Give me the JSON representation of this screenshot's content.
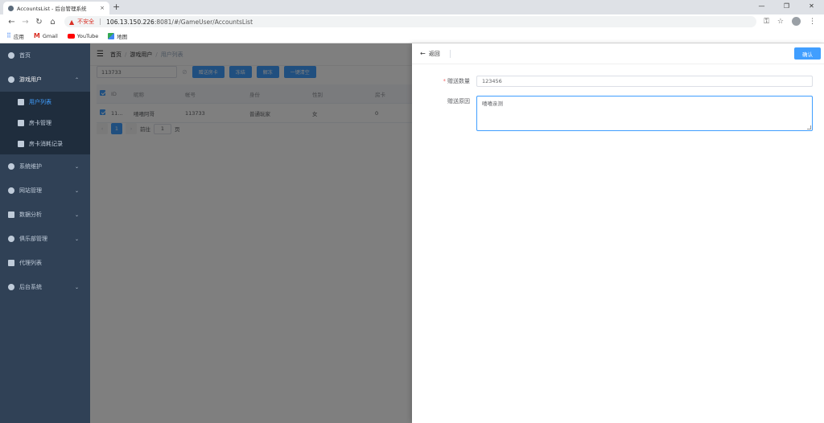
{
  "browser": {
    "tab_title": "AccountsList - 后台管理系统",
    "tab_close": "×",
    "new_tab": "+",
    "not_secure": "不安全",
    "url_host": "106.13.150.226",
    "url_rest": ":8081/#/GameUser/AccountsList",
    "bookmarks": [
      {
        "label": "应用",
        "icon": "apps-icon"
      },
      {
        "label": "Gmail",
        "icon": "gmail-icon"
      },
      {
        "label": "YouTube",
        "icon": "youtube-icon"
      },
      {
        "label": "地图",
        "icon": "maps-icon"
      }
    ]
  },
  "sidebar": {
    "items": [
      {
        "label": "首页",
        "icon": "dashboard-icon"
      },
      {
        "label": "游戏用户",
        "icon": "user-icon",
        "open": true,
        "children": [
          {
            "label": "用户列表",
            "icon": "list-icon",
            "active": true
          },
          {
            "label": "房卡管理",
            "icon": "card-icon"
          },
          {
            "label": "房卡消耗记录",
            "icon": "record-icon"
          }
        ]
      },
      {
        "label": "系统维护",
        "icon": "gear-icon"
      },
      {
        "label": "网站管理",
        "icon": "user-icon"
      },
      {
        "label": "数据分析",
        "icon": "chart-icon"
      },
      {
        "label": "俱乐部管理",
        "icon": "user-icon"
      },
      {
        "label": "代理列表",
        "icon": "list-icon"
      },
      {
        "label": "后台系统",
        "icon": "user-icon"
      }
    ]
  },
  "breadcrumb": [
    "首页",
    "游戏用户",
    "用户列表"
  ],
  "filter": {
    "search_value": "113733",
    "buttons": [
      "赠送房卡",
      "冻结",
      "解冻",
      "一键清空"
    ]
  },
  "table": {
    "headers": [
      "ID",
      "昵称",
      "帐号",
      "身份",
      "性别",
      "房卡"
    ],
    "rows": [
      {
        "id": "11...",
        "nickname": "嘻嘻阿哥",
        "account": "113733",
        "role": "普通玩家",
        "gender": "女",
        "cards": "0"
      }
    ]
  },
  "pager": {
    "current": "1",
    "goto_label": "前往",
    "goto_value": "1",
    "page_suffix": "页"
  },
  "drawer": {
    "back_label": "返回",
    "confirm_label": "确认",
    "fields": [
      {
        "label": "赠送数量",
        "required": true,
        "value": "123456"
      },
      {
        "label": "赠送原因",
        "required": false,
        "value": "嘻嘻亲测"
      }
    ]
  },
  "colors": {
    "primary": "#409eff",
    "sidebar_bg": "#304156",
    "sidebar_sub_bg": "#1f2d3d"
  }
}
